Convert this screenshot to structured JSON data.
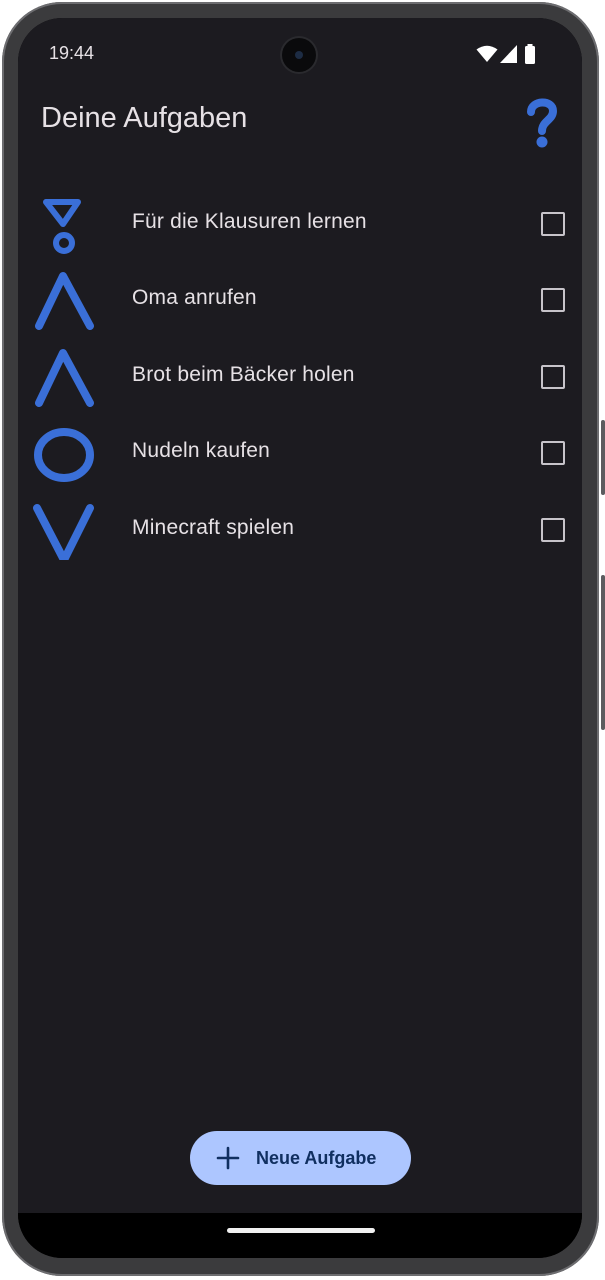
{
  "status_bar": {
    "time": "19:44",
    "icons": [
      "wifi-icon",
      "cellular-signal-icon",
      "battery-icon"
    ]
  },
  "app_bar": {
    "title": "Deine Aufgaben",
    "help_icon": "question-mark-icon"
  },
  "tasks": [
    {
      "label": "Für die Klausuren lernen",
      "priority_icon": "exclamation-triangle-icon",
      "checked": false
    },
    {
      "label": "Oma anrufen",
      "priority_icon": "chevron-up-icon",
      "checked": false
    },
    {
      "label": "Brot beim Bäcker holen",
      "priority_icon": "chevron-up-icon",
      "checked": false
    },
    {
      "label": "Nudeln kaufen",
      "priority_icon": "circle-icon",
      "checked": false
    },
    {
      "label": "Minecraft spielen",
      "priority_icon": "chevron-down-icon",
      "checked": false
    }
  ],
  "fab": {
    "label": "Neue Aufgabe",
    "icon": "plus-icon"
  },
  "colors": {
    "background": "#1c1b20",
    "text": "#e6e1e5",
    "accent_blue": "#3a6fd8",
    "fab_background": "#adc6ff",
    "fab_text": "#102f60"
  }
}
